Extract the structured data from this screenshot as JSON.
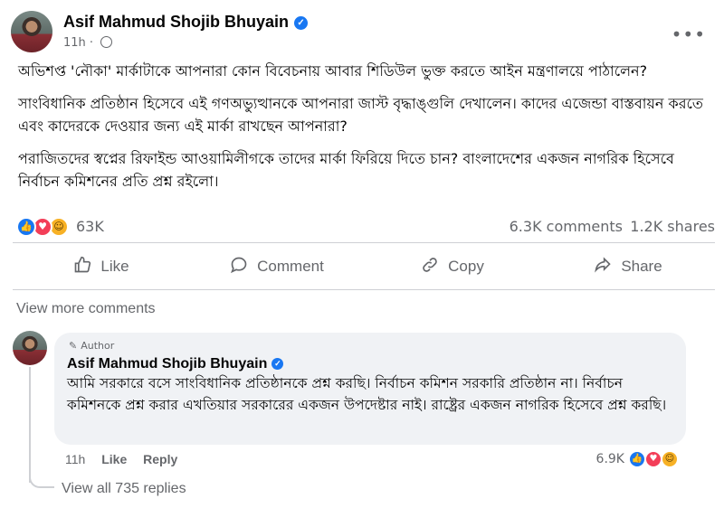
{
  "post": {
    "author": "Asif Mahmud Shojib Bhuyain",
    "time": "11h ·",
    "paragraphs": [
      "অভিশপ্ত 'নৌকা' মার্কাটাকে আপনারা কোন বিবেচনায় আবার শিডিউল ভুক্ত করতে আইন মন্ত্রণালয়ে পাঠালেন?",
      "সাংবিধানিক প্রতিষ্ঠান হিসেবে এই গণঅভ্যুত্থানকে আপনারা জাস্ট বৃদ্ধাঙ্গুলি দেখালেন। কাদের এজেন্ডা বাস্তবায়ন করতে এবং কাদেরকে দেওয়ার জন্য এই মার্কা রাখছেন আপনারা?",
      "পরাজিতদের স্বপ্নের রিফাইন্ড আওয়ামিলীগকে তাদের মার্কা ফিরিয়ে দিতে চান? বাংলাদেশের একজন নাগরিক হিসেবে নির্বাচন কমিশনের প্রতি প্রশ্ন রইলো।"
    ],
    "reaction_count": "63K",
    "comments_count": "6.3K comments",
    "shares_count": "1.2K shares"
  },
  "actions": {
    "like": "Like",
    "comment": "Comment",
    "copy": "Copy",
    "share": "Share"
  },
  "view_more_comments": "View more comments",
  "comment": {
    "badge": "Author",
    "author": "Asif Mahmud Shojib Bhuyain",
    "text": "আমি সরকারে বসে সাংবিধানিক প্রতিষ্ঠানকে প্রশ্ন করছি। নির্বাচন কমিশন সরকারি প্রতিষ্ঠান না। নির্বাচন কমিশনকে প্রশ্ন করার এখতিয়ার সরকারের একজন উপদেষ্টার নাই। রাষ্ট্রের একজন নাগরিক হিসেবে প্রশ্ন করছি।",
    "time": "11h",
    "like": "Like",
    "reply": "Reply",
    "reaction_count": "6.9K",
    "view_replies": "View all 735 replies"
  },
  "icons": {
    "verified": "verified-check-icon",
    "privacy": "globe-icon",
    "more": "more-options-icon",
    "reactions": [
      "like-reaction-icon",
      "love-reaction-icon",
      "haha-reaction-icon"
    ]
  },
  "colors": {
    "accent": "#1877f2",
    "love": "#f33e58",
    "haha": "#f7b125",
    "secondary_text": "#65676b",
    "bubble": "#f0f2f5"
  }
}
